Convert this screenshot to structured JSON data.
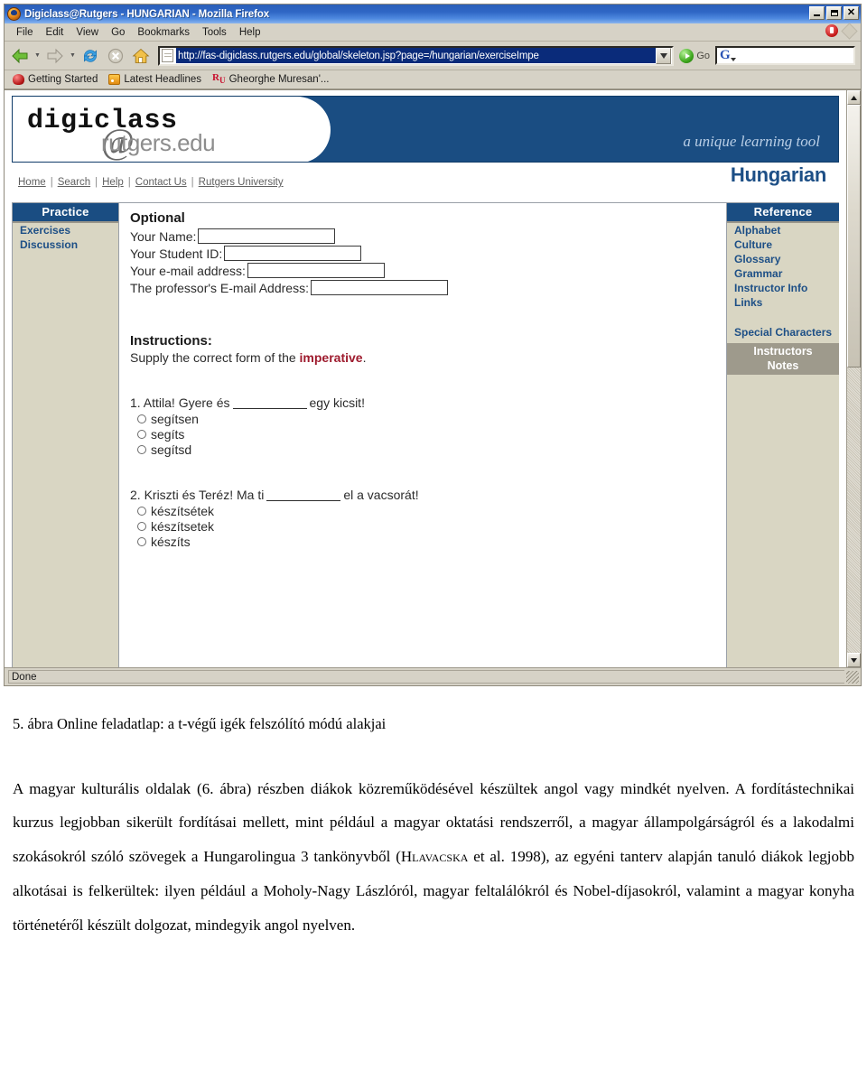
{
  "browser": {
    "title": "Digiclass@Rutgers - HUNGARIAN - Mozilla Firefox",
    "window_buttons": {
      "minimize": "_",
      "maximize": "□",
      "close": "✕"
    },
    "menus": [
      "File",
      "Edit",
      "View",
      "Go",
      "Bookmarks",
      "Tools",
      "Help"
    ],
    "url": "http://fas-digiclass.rutgers.edu/global/skeleton.jsp?page=/hungarian/exerciseImpe",
    "go_label": "Go",
    "search_engine_icon": "google-g-icon",
    "search_value": "",
    "bookmarks": [
      "Getting Started",
      "Latest Headlines",
      "Gheorghe Muresan'..."
    ],
    "status": "Done"
  },
  "page": {
    "logo": {
      "primary": "digiclass",
      "at": "@",
      "secondary": "rutgers.edu"
    },
    "tagline": "a unique learning tool",
    "language_title": "Hungarian",
    "topnav": [
      "Home",
      "Search",
      "Help",
      "Contact Us",
      "Rutgers University"
    ],
    "left_sidebar": {
      "header": "Practice",
      "items": [
        "Exercises",
        "Discussion"
      ]
    },
    "right_sidebar": {
      "header": "Reference",
      "items": [
        "Alphabet",
        "Culture",
        "Glossary",
        "Grammar",
        "Instructor Info",
        "Links"
      ],
      "special": "Special Characters",
      "sub_header_line1": "Instructors",
      "sub_header_line2": "Notes"
    },
    "form": {
      "title": "Optional",
      "fields": [
        {
          "label": "Your Name:",
          "value": "",
          "width_class": "w-name"
        },
        {
          "label": "Your Student ID:",
          "value": "",
          "width_class": "w-sid"
        },
        {
          "label": "Your e-mail address:",
          "value": "",
          "width_class": "w-email"
        },
        {
          "label": "The professor's E-mail Address:",
          "value": "",
          "width_class": "w-prof"
        }
      ]
    },
    "instructions": {
      "title": "Instructions:",
      "text_before": "Supply the correct form of the ",
      "highlight": "imperative",
      "text_after": "."
    },
    "questions": [
      {
        "prefix": "1. Attila! Gyere és",
        "suffix": "egy kicsit!",
        "options": [
          "segítsen",
          "segíts",
          "segítsd"
        ]
      },
      {
        "prefix": "2. Kriszti és Teréz! Ma ti",
        "suffix": "el a vacsorát!",
        "options": [
          "készítsétek",
          "készítsetek",
          "készíts"
        ]
      }
    ]
  },
  "document": {
    "figure_caption": "5. ábra Online feladatlap: a t-végű igék felszólító módú alakjai",
    "paragraph_part1": "A magyar kulturális oldalak (6. ábra) részben diákok közreműködésével készültek angol vagy mindkét nyelven. A fordítástechnikai kurzus legjobban sikerült fordításai mellett, mint például a magyar oktatási rendszerről, a magyar állampolgárságról és a lakodalmi szokásokról szóló szövegek a Hungarolingua 3 tankönyvből (",
    "citation_smallcaps": "Hlavacska",
    "paragraph_part2": " et al. 1998), az egyéni tanterv alapján tanuló diákok legjobb alkotásai is felkerültek: ilyen például a Moholy-Nagy Lászlóról, magyar feltalálókról és Nobel-díjasokról, valamint a magyar konyha történetéről készült dolgozat, mindegyik angol nyelven."
  }
}
